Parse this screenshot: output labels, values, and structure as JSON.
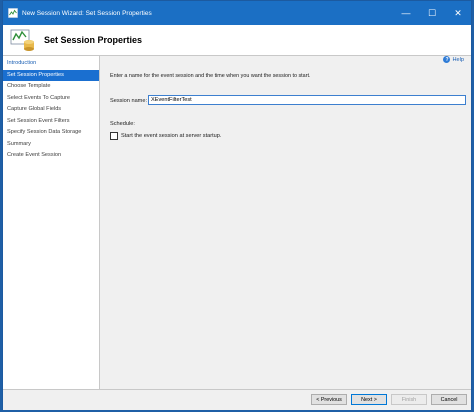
{
  "window": {
    "title": "New Session Wizard: Set Session Properties",
    "minimize": "—",
    "maximize": "☐",
    "close": "✕"
  },
  "header": {
    "heading": "Set Session Properties"
  },
  "sidebar": {
    "items": [
      {
        "label": "Introduction",
        "state": "link"
      },
      {
        "label": "Set Session Properties",
        "state": "selected"
      },
      {
        "label": "Choose Template",
        "state": "normal"
      },
      {
        "label": "Select Events To Capture",
        "state": "normal"
      },
      {
        "label": "Capture Global Fields",
        "state": "normal"
      },
      {
        "label": "Set Session Event Filters",
        "state": "normal"
      },
      {
        "label": "Specify Session Data Storage",
        "state": "normal"
      },
      {
        "label": "Summary",
        "state": "normal"
      },
      {
        "label": "Create Event Session",
        "state": "normal"
      }
    ]
  },
  "content": {
    "help_label": "Help",
    "help_icon_glyph": "?",
    "instructions": "Enter a name for the event session and the time when you want the session to start.",
    "session_name_label": "Session name:",
    "session_name_value": "XEventFilterTest",
    "schedule_label": "Schedule:",
    "start_at_startup_label": "Start the event session at server startup."
  },
  "footer": {
    "previous_label": "< Previous",
    "next_label": "Next >",
    "finish_label": "Finish",
    "cancel_label": "Cancel"
  },
  "colors": {
    "titlebar": "#1b6fc4",
    "selected": "#1a6fd0",
    "link": "#1a5fb4"
  }
}
